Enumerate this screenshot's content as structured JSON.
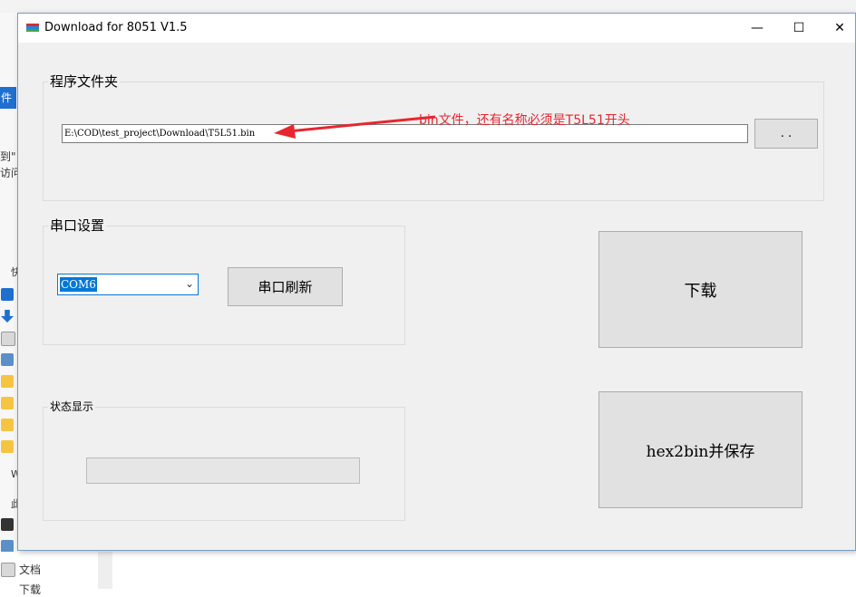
{
  "window": {
    "title": "Download for 8051 V1.5",
    "minimize_glyph": "—",
    "maximize_glyph": "☐",
    "close_glyph": "✕"
  },
  "program_folder": {
    "label": "程序文件夹",
    "path_value": "E:\\COD\\test_project\\Download\\T5L51.bin",
    "browse_label": ". ."
  },
  "serial": {
    "label": "串口设置",
    "port_value": "COM6",
    "refresh_label": "串口刷新"
  },
  "status": {
    "label": "状态显示",
    "progress": 0
  },
  "actions": {
    "download_label": "下载",
    "hex2bin_label": "hex2bin并保存"
  },
  "annotation": {
    "text": "bin文件，还有名称必须是T5L51开头",
    "color": "#e8262f"
  },
  "background": {
    "tab_text": "件",
    "line1": "到\"",
    "line2": "访问",
    "nav_docs": "文档",
    "nav_downloads": "下载",
    "tree_char1": "快",
    "tree_char2": "W",
    "tree_char3": "此"
  }
}
